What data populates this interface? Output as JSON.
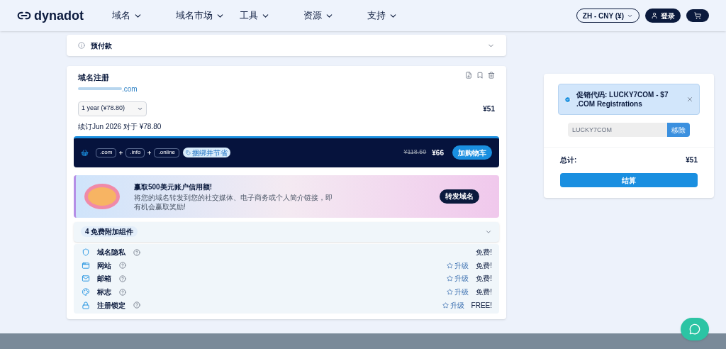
{
  "header": {
    "logo": "dynadot",
    "nav": [
      {
        "label": "域名"
      },
      {
        "label": "域名市场"
      },
      {
        "label": "工具"
      },
      {
        "label": "资源"
      },
      {
        "label": "支持"
      }
    ],
    "currency": "ZH - CNY (¥)",
    "login": "登录"
  },
  "prepay": {
    "label": "预付款",
    "expanded": false
  },
  "item": {
    "title": "域名注册",
    "domain_suffix": ".com",
    "term": "1 year (¥78.80)",
    "price": "¥51",
    "renewal": "续订Jun 2026 对于 ¥78.80",
    "bundle": {
      "tlds": [
        ".com",
        ".info",
        ".online"
      ],
      "tag": "捆绑并节省",
      "old_price": "¥118.50",
      "price": "¥66",
      "button": "加购物车"
    },
    "promo": {
      "title": "赢取500美元账户信用额!",
      "text": "将您的域名转发到您的社交媒体、电子商务或个人简介链接，即有机会赢取奖励!",
      "button": "转发域名"
    },
    "addons": {
      "label": "4 免费附加组件",
      "expanded": false,
      "rows": [
        {
          "kind": "shield",
          "name": "域名隐私",
          "upgrade": "",
          "price": "免费!"
        },
        {
          "kind": "website",
          "name": "网站",
          "upgrade": "升级",
          "price": "免费!"
        },
        {
          "kind": "mail",
          "name": "邮箱",
          "upgrade": "升级",
          "price": "免费!"
        },
        {
          "kind": "palette",
          "name": "标志",
          "upgrade": "升级",
          "price": "免费!"
        },
        {
          "kind": "lock",
          "name": "注册锁定",
          "upgrade": "升级",
          "price": "FREE!"
        }
      ]
    }
  },
  "summary": {
    "promo_notice": "促销代码: LUCKY7COM - $7 .COM Registrations",
    "code": "LUCKY7COM",
    "remove": "移除",
    "total_label": "总计:",
    "total": "¥51",
    "checkout": "结算"
  }
}
